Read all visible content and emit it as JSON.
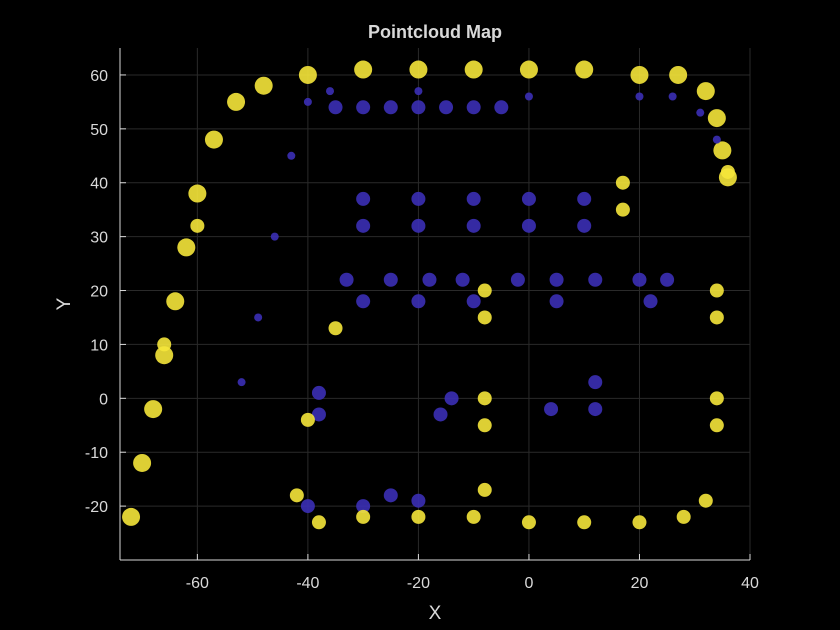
{
  "chart_data": {
    "type": "scatter",
    "title": "Pointcloud Map",
    "xlabel": "X",
    "ylabel": "Y",
    "xlim": [
      -74,
      40
    ],
    "ylim": [
      -30,
      65
    ],
    "xticks": [
      -60,
      -40,
      -20,
      0,
      20,
      40
    ],
    "yticks": [
      -20,
      -10,
      0,
      10,
      20,
      30,
      40,
      50,
      60
    ],
    "grid": true,
    "colormap": "parula (height-coded points)",
    "colors": {
      "background": "#000000",
      "text": "#d9d9d9",
      "low": "#3b2fb5",
      "mid": "#2fa0d8",
      "high": "#f5e53a"
    },
    "series": [
      {
        "points": [
          [
            -72,
            -22
          ],
          [
            -70,
            -12
          ],
          [
            -68,
            -2
          ],
          [
            -66,
            8
          ],
          [
            -64,
            18
          ],
          [
            -62,
            28
          ],
          [
            -60,
            38
          ],
          [
            -57,
            48
          ],
          [
            -53,
            55
          ],
          [
            -48,
            58
          ],
          [
            -40,
            60
          ],
          [
            -30,
            61
          ],
          [
            -20,
            61
          ],
          [
            -10,
            61
          ],
          [
            0,
            61
          ],
          [
            10,
            61
          ],
          [
            20,
            60
          ],
          [
            27,
            60
          ],
          [
            32,
            57
          ],
          [
            34,
            52
          ],
          [
            35,
            46
          ],
          [
            36,
            41
          ]
        ]
      },
      {
        "points": [
          [
            -52,
            3
          ],
          [
            -49,
            15
          ],
          [
            -46,
            30
          ],
          [
            -43,
            45
          ],
          [
            -40,
            55
          ],
          [
            -36,
            57
          ],
          [
            -20,
            57
          ],
          [
            0,
            56
          ],
          [
            20,
            56
          ],
          [
            26,
            56
          ],
          [
            31,
            53
          ],
          [
            34,
            48
          ]
        ]
      },
      {
        "points": [
          [
            -35,
            54
          ],
          [
            -30,
            54
          ],
          [
            -25,
            54
          ],
          [
            -20,
            54
          ],
          [
            -15,
            54
          ],
          [
            -10,
            54
          ],
          [
            -5,
            54
          ],
          [
            -30,
            37
          ],
          [
            -20,
            37
          ],
          [
            -10,
            37
          ],
          [
            0,
            37
          ],
          [
            10,
            37
          ],
          [
            -30,
            32
          ],
          [
            -20,
            32
          ],
          [
            -10,
            32
          ],
          [
            0,
            32
          ],
          [
            10,
            32
          ],
          [
            -33,
            22
          ],
          [
            -25,
            22
          ],
          [
            -18,
            22
          ],
          [
            -12,
            22
          ],
          [
            -2,
            22
          ],
          [
            5,
            22
          ],
          [
            12,
            22
          ],
          [
            20,
            22
          ],
          [
            25,
            22
          ],
          [
            -30,
            18
          ],
          [
            -20,
            18
          ],
          [
            -10,
            18
          ],
          [
            5,
            18
          ],
          [
            22,
            18
          ],
          [
            -14,
            0
          ],
          [
            -38,
            1
          ],
          [
            -38,
            -3
          ],
          [
            -16,
            -3
          ],
          [
            4,
            -2
          ],
          [
            12,
            -2
          ],
          [
            12,
            3
          ],
          [
            -40,
            -20
          ],
          [
            -25,
            -18
          ],
          [
            -20,
            -19
          ],
          [
            -30,
            -20
          ]
        ]
      },
      {
        "points": [
          [
            -35,
            13
          ],
          [
            -40,
            -4
          ],
          [
            -8,
            20
          ],
          [
            -8,
            15
          ],
          [
            -8,
            0
          ],
          [
            -8,
            -5
          ],
          [
            17,
            40
          ],
          [
            17,
            35
          ],
          [
            34,
            20
          ],
          [
            34,
            15
          ],
          [
            34,
            0
          ],
          [
            34,
            -5
          ],
          [
            -42,
            -18
          ],
          [
            -8,
            -17
          ],
          [
            32,
            -19
          ],
          [
            -38,
            -23
          ],
          [
            -30,
            -22
          ],
          [
            -20,
            -22
          ],
          [
            -10,
            -22
          ],
          [
            0,
            -23
          ],
          [
            10,
            -23
          ],
          [
            20,
            -23
          ],
          [
            28,
            -22
          ],
          [
            36,
            42
          ],
          [
            -60,
            32
          ],
          [
            -66,
            10
          ]
        ]
      }
    ]
  }
}
